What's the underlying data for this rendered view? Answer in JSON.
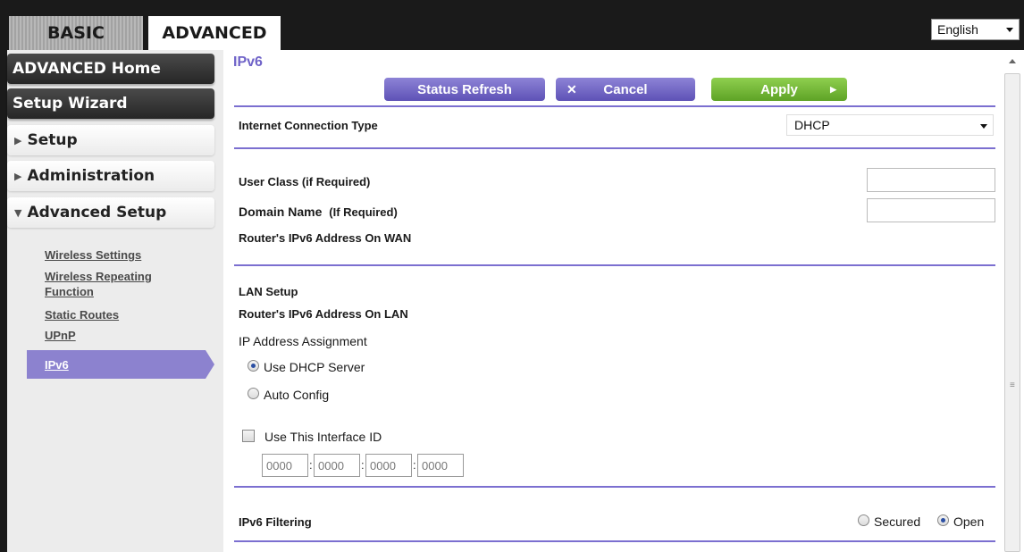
{
  "tabs": {
    "basic": "BASIC",
    "advanced": "ADVANCED"
  },
  "language": {
    "selected": "English"
  },
  "sidebar": {
    "advanced_home": "ADVANCED Home",
    "setup_wizard": "Setup Wizard",
    "setup": "Setup",
    "administration": "Administration",
    "advanced_setup": "Advanced Setup",
    "sub_items": [
      "Wireless Settings",
      "Wireless Repeating",
      "Function",
      "Static Routes",
      "UPnP"
    ],
    "active_item": "IPv6"
  },
  "main": {
    "title": "IPv6",
    "buttons": {
      "refresh": "Status Refresh",
      "cancel": "Cancel",
      "apply": "Apply"
    },
    "connection_type": {
      "label": "Internet Connection Type",
      "value": "DHCP"
    },
    "user_class": {
      "label": "User Class (if Required)",
      "value": ""
    },
    "domain_name": {
      "label": "Domain Name",
      "hint": "(If Required)",
      "value": ""
    },
    "wan_address": {
      "label": "Router's IPv6 Address On WAN",
      "value": ""
    },
    "lan_setup": "LAN Setup",
    "lan_address": {
      "label": "Router's IPv6 Address On LAN",
      "value": ""
    },
    "ip_assignment": {
      "label": "IP Address Assignment",
      "options": [
        "Use DHCP Server",
        "Auto Config"
      ],
      "selected": "Use DHCP Server"
    },
    "interface_id": {
      "label": "Use This Interface ID",
      "checked": false,
      "fields": [
        "0000",
        "0000",
        "0000",
        "0000"
      ]
    },
    "filtering": {
      "label": "IPv6 Filtering",
      "options": [
        "Secured",
        "Open"
      ],
      "selected": "Open"
    }
  },
  "colors": {
    "accent_purple": "#7b6fd0",
    "apply_green": "#6db52f",
    "sidebar_dark": "#333333"
  }
}
